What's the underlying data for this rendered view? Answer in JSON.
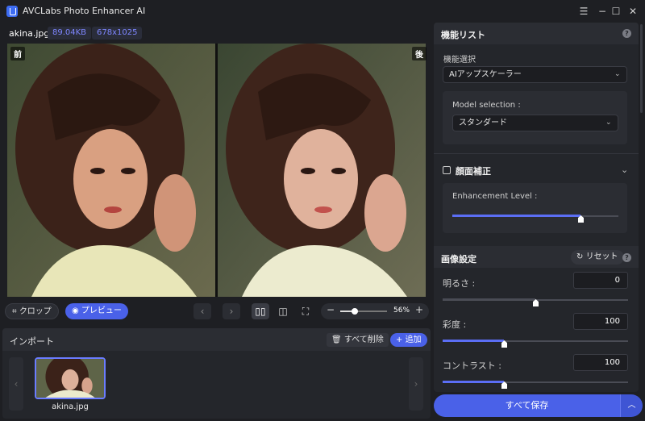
{
  "window": {
    "title": "AVCLabs Photo Enhancer AI",
    "menu_icon": "☰",
    "minimize_icon": "−",
    "maximize_icon": "☐",
    "close_icon": "✕"
  },
  "file_info": {
    "name": "akina.jpg",
    "size": "89.04KB",
    "dimensions": "678x1025"
  },
  "preview": {
    "before_label": "前",
    "after_label": "後"
  },
  "toolbar": {
    "crop_label": "クロップ",
    "preview_label": "プレビュー",
    "prev_icon": "‹",
    "next_icon": "›",
    "zoom_out_icon": "−",
    "zoom_in_icon": "+",
    "zoom_value": "56%",
    "zoom_fraction": 0.56
  },
  "import": {
    "title": "インポート",
    "clear_all_label": "すべて削除",
    "add_label": "追加",
    "items": [
      {
        "name": "akina.jpg"
      }
    ]
  },
  "features": {
    "title": "機能リスト",
    "select_label": "機能選択",
    "selected_feature": "AIアップスケーラー",
    "model_label": "Model selection :",
    "model_value": "スタンダード",
    "face_label": "顔面補正",
    "face_checked": false,
    "enhancement_label": "Enhancement Level :",
    "enhancement_level": 0.77
  },
  "image_settings": {
    "title": "画像設定",
    "reset_label": "リセット",
    "brightness": {
      "label": "明るさ :",
      "value": "0",
      "level": 0.5
    },
    "saturation": {
      "label": "彩度 :",
      "value": "100",
      "level": 0.33
    },
    "contrast": {
      "label": "コントラスト :",
      "value": "100",
      "level": 0.33
    }
  },
  "footer": {
    "save_all_label": "すべて保存"
  },
  "colors": {
    "accent": "#4a61e8",
    "background": "#1e1f23",
    "panel": "#24262b"
  }
}
